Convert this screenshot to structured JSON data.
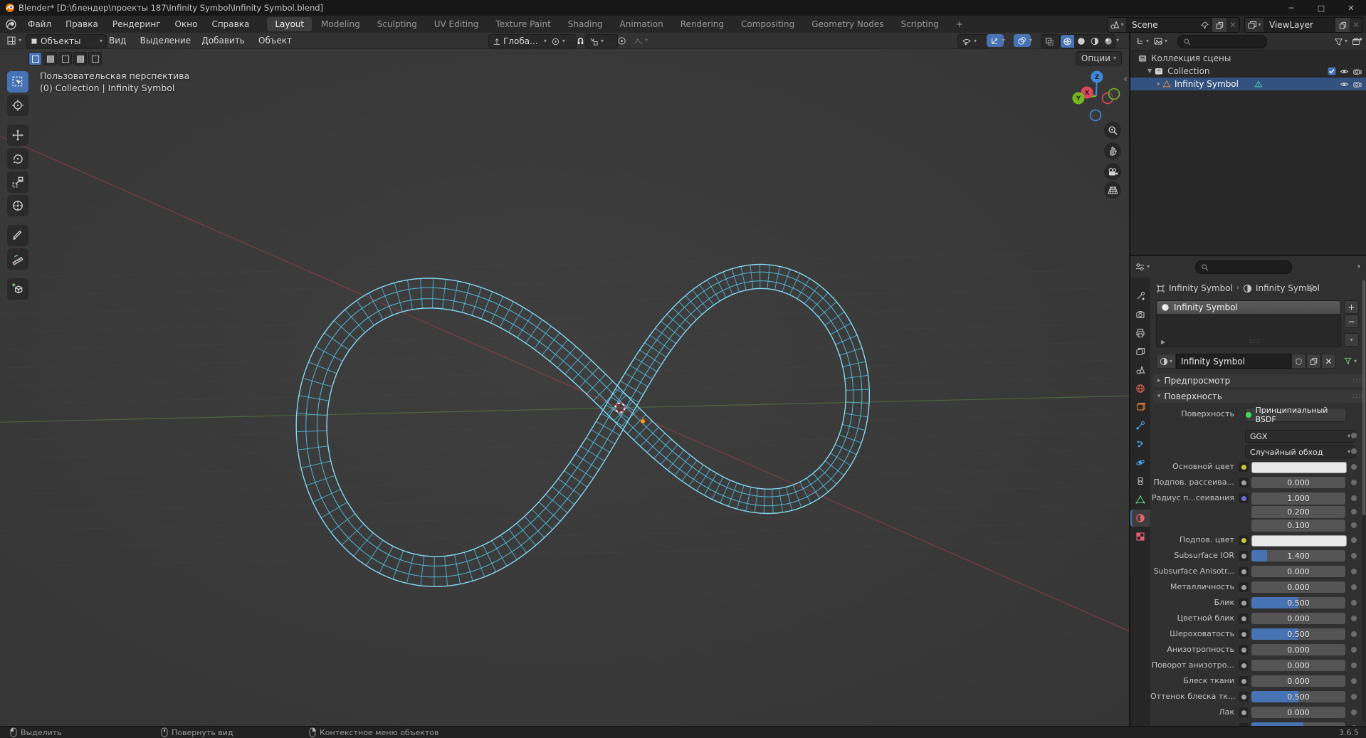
{
  "app": {
    "title": "Blender* [D:\\блендер\\проекты 187\\Infinity Symbol\\Infinity Symbol.blend]",
    "version": "3.6.5"
  },
  "colors": {
    "accent": "#4772b3",
    "wire": "#54c6ea",
    "axis_x": "#b2414a",
    "axis_y": "#5c8b42",
    "selected_row": "#33517e"
  },
  "topbar": {
    "menus": [
      "Файл",
      "Правка",
      "Рендеринг",
      "Окно",
      "Справка"
    ],
    "tabs": [
      "Layout",
      "Modeling",
      "Sculpting",
      "UV Editing",
      "Texture Paint",
      "Shading",
      "Animation",
      "Rendering",
      "Compositing",
      "Geometry Nodes",
      "Scripting"
    ],
    "active_tab": "Layout",
    "new_tab": "+",
    "scene": {
      "label": "Scene",
      "icon": "scene-icon"
    },
    "view_layer": {
      "label": "ViewLayer",
      "icon": "viewlayer-icon"
    }
  },
  "viewport": {
    "header": {
      "mode": "Объекты",
      "menus": [
        "Вид",
        "Выделение",
        "Добавить",
        "Объект"
      ],
      "orientation": "Глоба...",
      "options": "Опции"
    },
    "overlay": {
      "line1": "Пользовательская перспектива",
      "line2": "(0) Collection | Infinity Symbol"
    },
    "object": "Infinity Symbol",
    "gizmo_axes": [
      "X",
      "Y",
      "Z"
    ],
    "nav_buttons": [
      "zoom-icon",
      "pan-hand-icon",
      "camera-view-icon",
      "ortho-grid-icon"
    ]
  },
  "toolbar_tools": [
    "select-box",
    "cursor",
    "move",
    "rotate",
    "scale",
    "transform",
    "annotate",
    "measure",
    "add-cube"
  ],
  "outliner": {
    "rows": [
      {
        "label": "Коллекция сцены",
        "icon": "scene-collection-icon",
        "indent": 0,
        "controls": []
      },
      {
        "label": "Collection",
        "icon": "collection-icon",
        "indent": 1,
        "expanded": true,
        "controls": [
          "checkbox",
          "eye",
          "camera"
        ]
      },
      {
        "label": "Infinity Symbol",
        "icon": "mesh-object-icon",
        "data_icon": "mesh-data-icon",
        "indent": 2,
        "selected": true,
        "controls": [
          "eye",
          "camera"
        ]
      }
    ]
  },
  "properties": {
    "tabs": [
      {
        "icon": "tool-icon"
      },
      {
        "icon": "render-icon"
      },
      {
        "icon": "output-icon"
      },
      {
        "icon": "viewlayer-icon"
      },
      {
        "icon": "scene-icon"
      },
      {
        "icon": "world-icon"
      },
      {
        "icon": "object-icon"
      },
      {
        "icon": "modifiers-icon"
      },
      {
        "icon": "particles-icon"
      },
      {
        "icon": "physics-icon"
      },
      {
        "icon": "constraints-icon"
      },
      {
        "icon": "data-icon"
      },
      {
        "icon": "material-icon",
        "active": true
      },
      {
        "icon": "texture-icon"
      }
    ],
    "breadcrumb": {
      "object": "Infinity Symbol",
      "material": "Infinity Symbol"
    },
    "slot": {
      "name": "Infinity Symbol"
    },
    "datablock": {
      "name": "Infinity Symbol"
    },
    "panels": {
      "preview": "Предпросмотр",
      "surface": "Поверхность"
    },
    "rows": [
      {
        "label": "Поверхность",
        "type": "button",
        "text": "Принципиальный BSDF",
        "dot": "#3ddc5a",
        "decorator": false
      },
      {
        "label": "",
        "type": "dropdown",
        "text": "GGX",
        "decorator": true
      },
      {
        "label": "",
        "type": "dropdown",
        "text": "Случайный обход",
        "decorator": true
      },
      {
        "label": "Основной цвет",
        "type": "color",
        "socket": "#c7c732",
        "decorator": true
      },
      {
        "label": "Подпов. рассеива...",
        "type": "slider",
        "text": "0.000",
        "fill": 0,
        "socket": "#a1a1a1",
        "decorator": true
      },
      {
        "label": "Радиус п...сеивания",
        "type": "multi",
        "values": [
          "1.000",
          "0.200",
          "0.100"
        ],
        "socket": "#7070d8",
        "decorator": true
      },
      {
        "label": "Подпов. цвет",
        "type": "color",
        "socket": "#c7c732",
        "decorator": true
      },
      {
        "label": "Subsurface IOR",
        "type": "slider",
        "text": "1.400",
        "fill": 0.17,
        "socket": "#a1a1a1",
        "decorator": true
      },
      {
        "label": "Subsurface Anisotr...",
        "type": "slider",
        "text": "0.000",
        "fill": 0,
        "socket": "#a1a1a1",
        "decorator": true
      },
      {
        "label": "Металличность",
        "type": "slider",
        "text": "0.000",
        "fill": 0,
        "socket": "#a1a1a1",
        "decorator": true
      },
      {
        "label": "Блик",
        "type": "slider",
        "text": "0.500",
        "fill": 0.5,
        "socket": "#a1a1a1",
        "decorator": true
      },
      {
        "label": "Цветной блик",
        "type": "slider",
        "text": "0.000",
        "fill": 0,
        "socket": "#a1a1a1",
        "decorator": true
      },
      {
        "label": "Шероховатость",
        "type": "slider",
        "text": "0.500",
        "fill": 0.5,
        "socket": "#a1a1a1",
        "decorator": true
      },
      {
        "label": "Анизотропность",
        "type": "slider",
        "text": "0.000",
        "fill": 0,
        "socket": "#a1a1a1",
        "decorator": true
      },
      {
        "label": "Поворот анизотро...",
        "type": "slider",
        "text": "0.000",
        "fill": 0,
        "socket": "#a1a1a1",
        "decorator": true
      },
      {
        "label": "Блеск ткани",
        "type": "slider",
        "text": "0.000",
        "fill": 0,
        "socket": "#a1a1a1",
        "decorator": true
      },
      {
        "label": "Оттенок блеска тк...",
        "type": "slider",
        "text": "0.500",
        "fill": 0.5,
        "socket": "#a1a1a1",
        "decorator": true
      },
      {
        "label": "Лак",
        "type": "slider",
        "text": "0.000",
        "fill": 0,
        "socket": "#a1a1a1",
        "decorator": true
      },
      {
        "label": "",
        "type": "slider",
        "text": "",
        "fill": 0.55,
        "socket": "#a1a1a1",
        "decorator": true,
        "partial": true
      }
    ]
  },
  "statusbar": {
    "items": [
      {
        "button": "mouse-left-icon",
        "label": "Выделить"
      },
      {
        "button": "mouse-middle-icon",
        "label": "Повернуть вид"
      },
      {
        "button": "mouse-right-icon",
        "label": "Контекстное меню объектов"
      }
    ]
  }
}
